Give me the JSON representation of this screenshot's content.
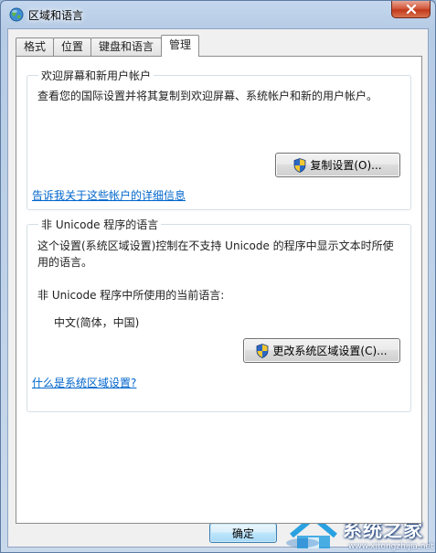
{
  "window": {
    "title": "区域和语言"
  },
  "tabs": [
    {
      "label": "格式"
    },
    {
      "label": "位置"
    },
    {
      "label": "键盘和语言"
    },
    {
      "label": "管理"
    }
  ],
  "welcome_group": {
    "title": "欢迎屏幕和新用户帐户",
    "description": "查看您的国际设置并将其复制到欢迎屏幕、系统帐户和新的用户帐户。",
    "copy_button": "复制设置(O)...",
    "link": "告诉我关于这些帐户的详细信息"
  },
  "unicode_group": {
    "title": "非 Unicode 程序的语言",
    "description_line1": "这个设置(系统区域设置)控制在不支持 Unicode 的程序中显示文本时所使",
    "description_line2": "用的语言。",
    "current_label": "非 Unicode 程序中所使用的当前语言:",
    "current_value": "中文(简体，中国)",
    "change_button": "更改系统区域设置(C)...",
    "link": "什么是系统区域设置?"
  },
  "footer": {
    "ok_button": "确定"
  },
  "watermark": {
    "text": "系统之家",
    "sub": "www.xitongzhijia.net"
  },
  "colors": {
    "link": "#0066cc",
    "close": "#c2391b"
  }
}
